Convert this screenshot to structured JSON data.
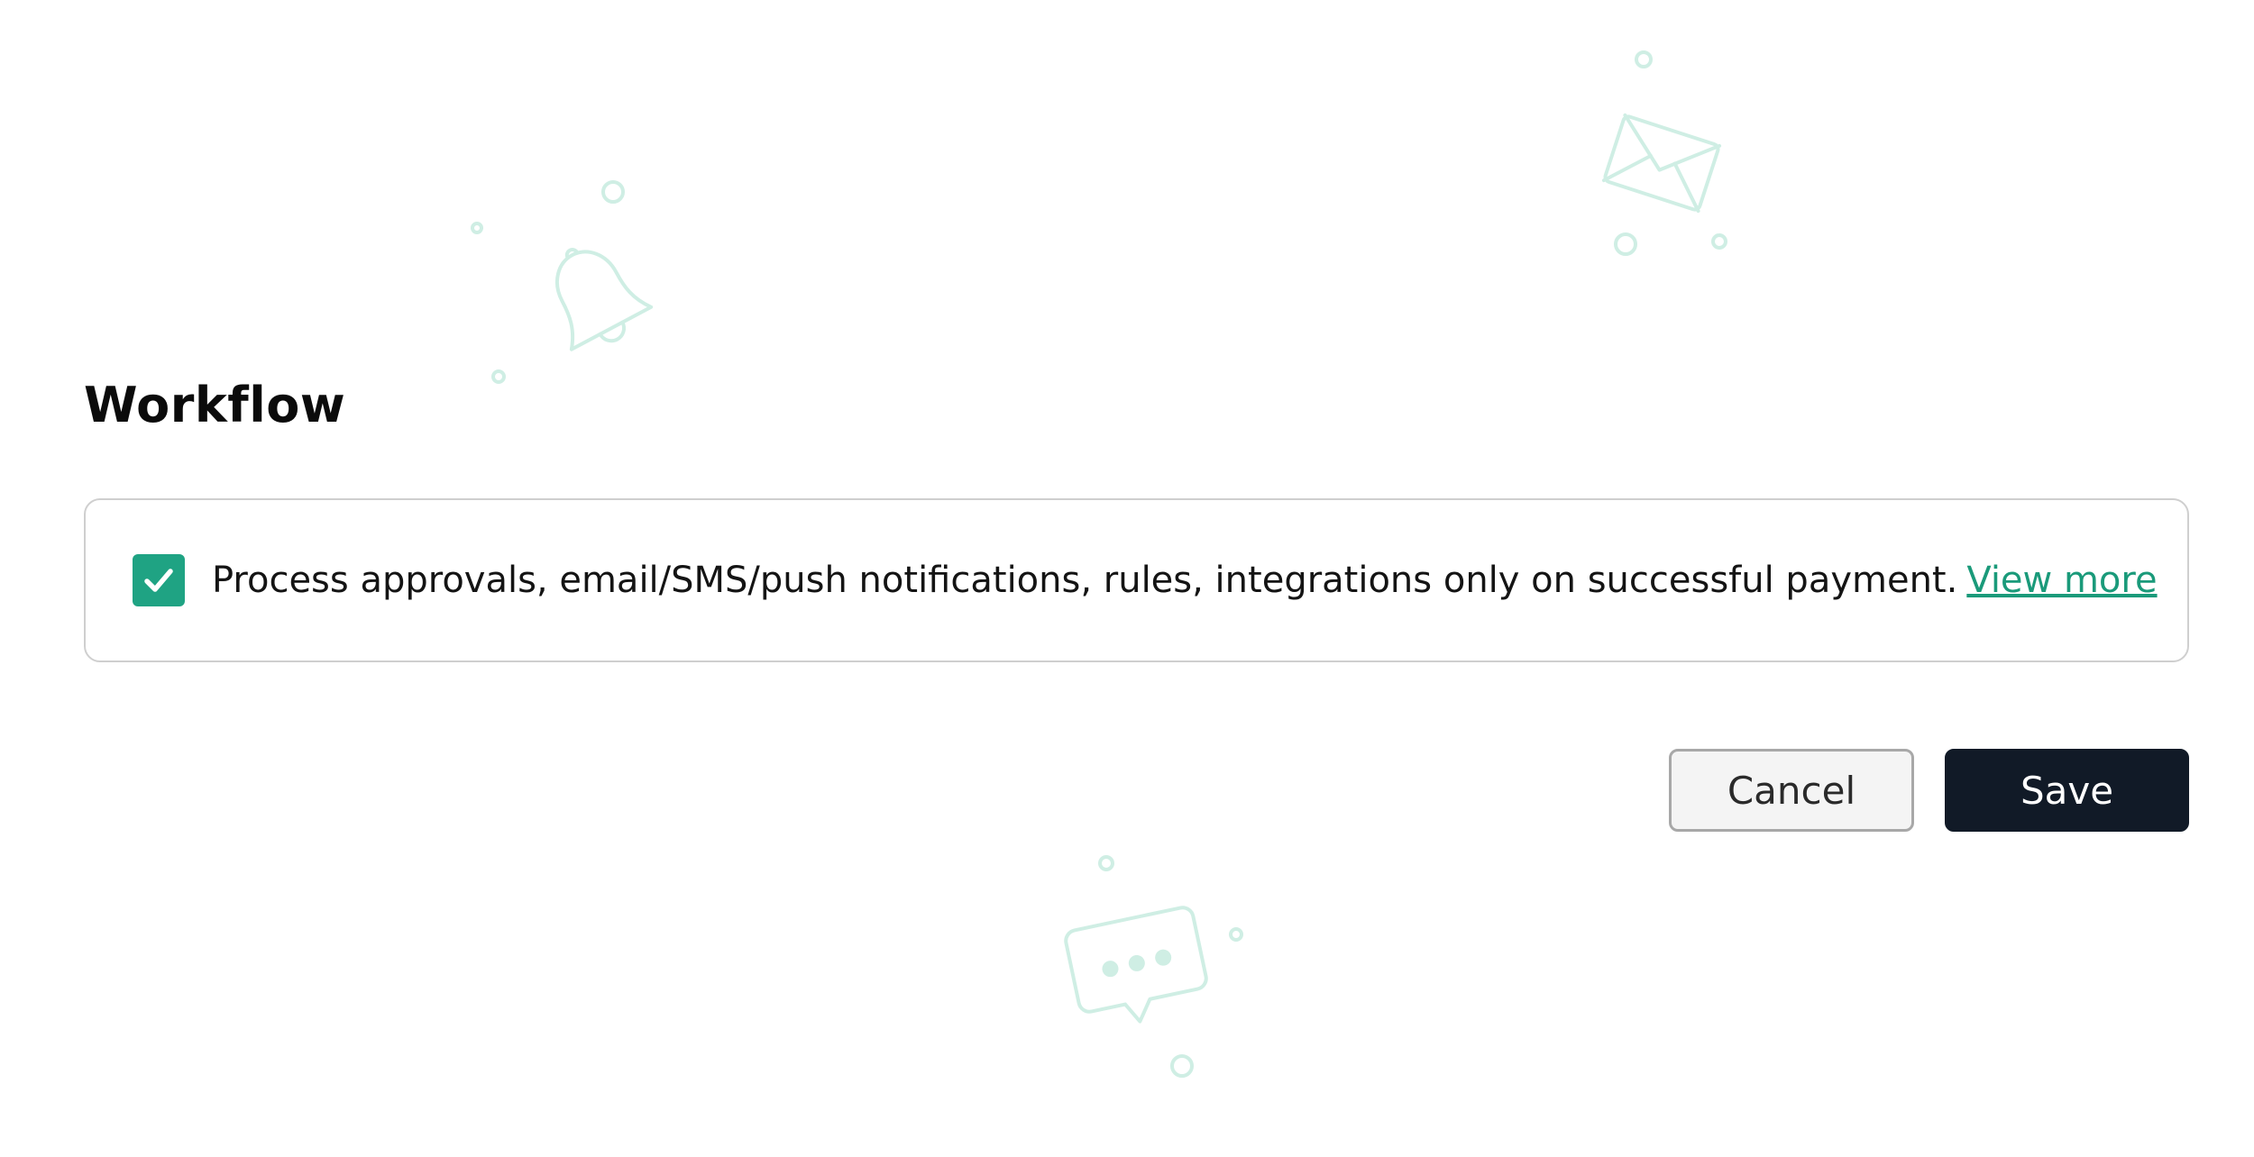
{
  "workflow": {
    "title": "Workflow",
    "option": {
      "checked": true,
      "text": "Process approvals, email/SMS/push notifications, rules, integrations only on successful payment.",
      "link_label": "View more"
    }
  },
  "actions": {
    "cancel_label": "Cancel",
    "save_label": "Save"
  },
  "decorations": {
    "color": "#cfeee4",
    "icons": [
      "bell-icon",
      "envelope-icon",
      "chat-bubble-icon"
    ]
  },
  "colors": {
    "accent": "#1fa383",
    "link": "#1a9a7a",
    "primary_button": "#111a27"
  }
}
